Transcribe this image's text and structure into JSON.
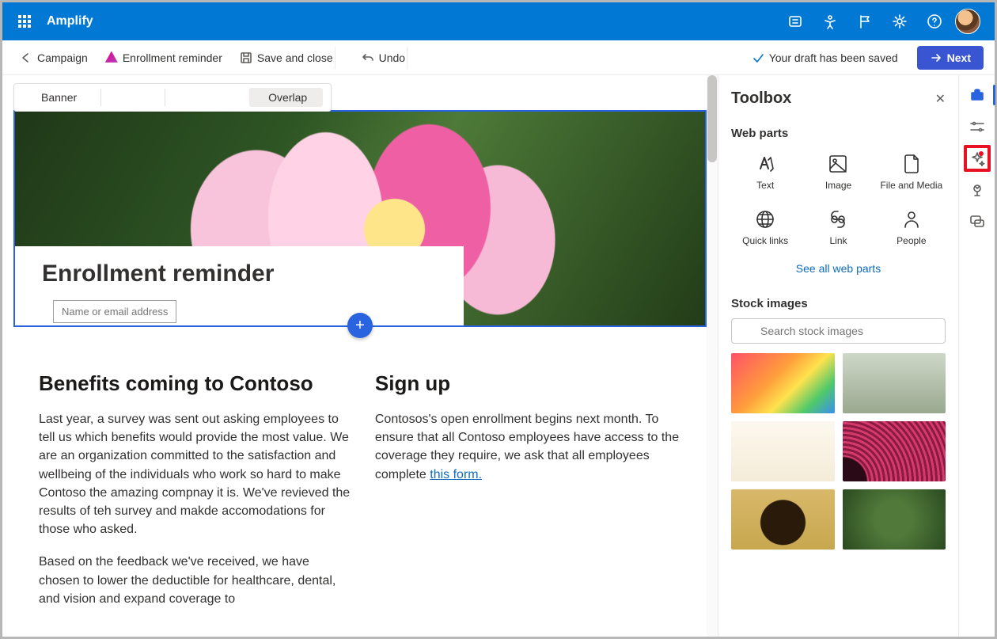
{
  "header": {
    "app_name": "Amplify"
  },
  "cmdbar": {
    "back_label": "Campaign",
    "doc_label": "Enrollment reminder",
    "save_label": "Save and close",
    "undo_label": "Undo",
    "draft_status": "Your draft has been saved",
    "next_label": "Next"
  },
  "float_toolbar": {
    "banner_label": "Banner",
    "overlap_label": "Overlap"
  },
  "banner": {
    "title": "Enrollment reminder",
    "name_placeholder": "Name or email address"
  },
  "content": {
    "left_heading": "Benefits coming to Contoso",
    "left_p1": "Last year, a survey was sent out asking employees to tell us which benefits would provide the most value. We are an organization committed to the satisfaction and wellbeing of the individuals who work so hard to make Contoso the amazing compnay it is. We've revieved the results of teh survey and makde accomodations for those who asked.",
    "left_p2": "Based on the feedback we've received, we have chosen to lower the deductible for healthcare, dental, and vision and expand coverage to",
    "right_heading": "Sign up",
    "right_p1_a": "Contosos's open enrollment begins next month. To ensure that all Contoso employees have access to the coverage they require, we ask that all employees complete ",
    "right_link": "this form. "
  },
  "toolbox": {
    "title": "Toolbox",
    "webparts_heading": "Web parts",
    "items": [
      {
        "label": "Text"
      },
      {
        "label": "Image"
      },
      {
        "label": "File and Media"
      },
      {
        "label": "Quick links"
      },
      {
        "label": "Link"
      },
      {
        "label": "People"
      }
    ],
    "see_all": "See all web parts",
    "stock_heading": "Stock images",
    "search_placeholder": "Search stock images"
  }
}
